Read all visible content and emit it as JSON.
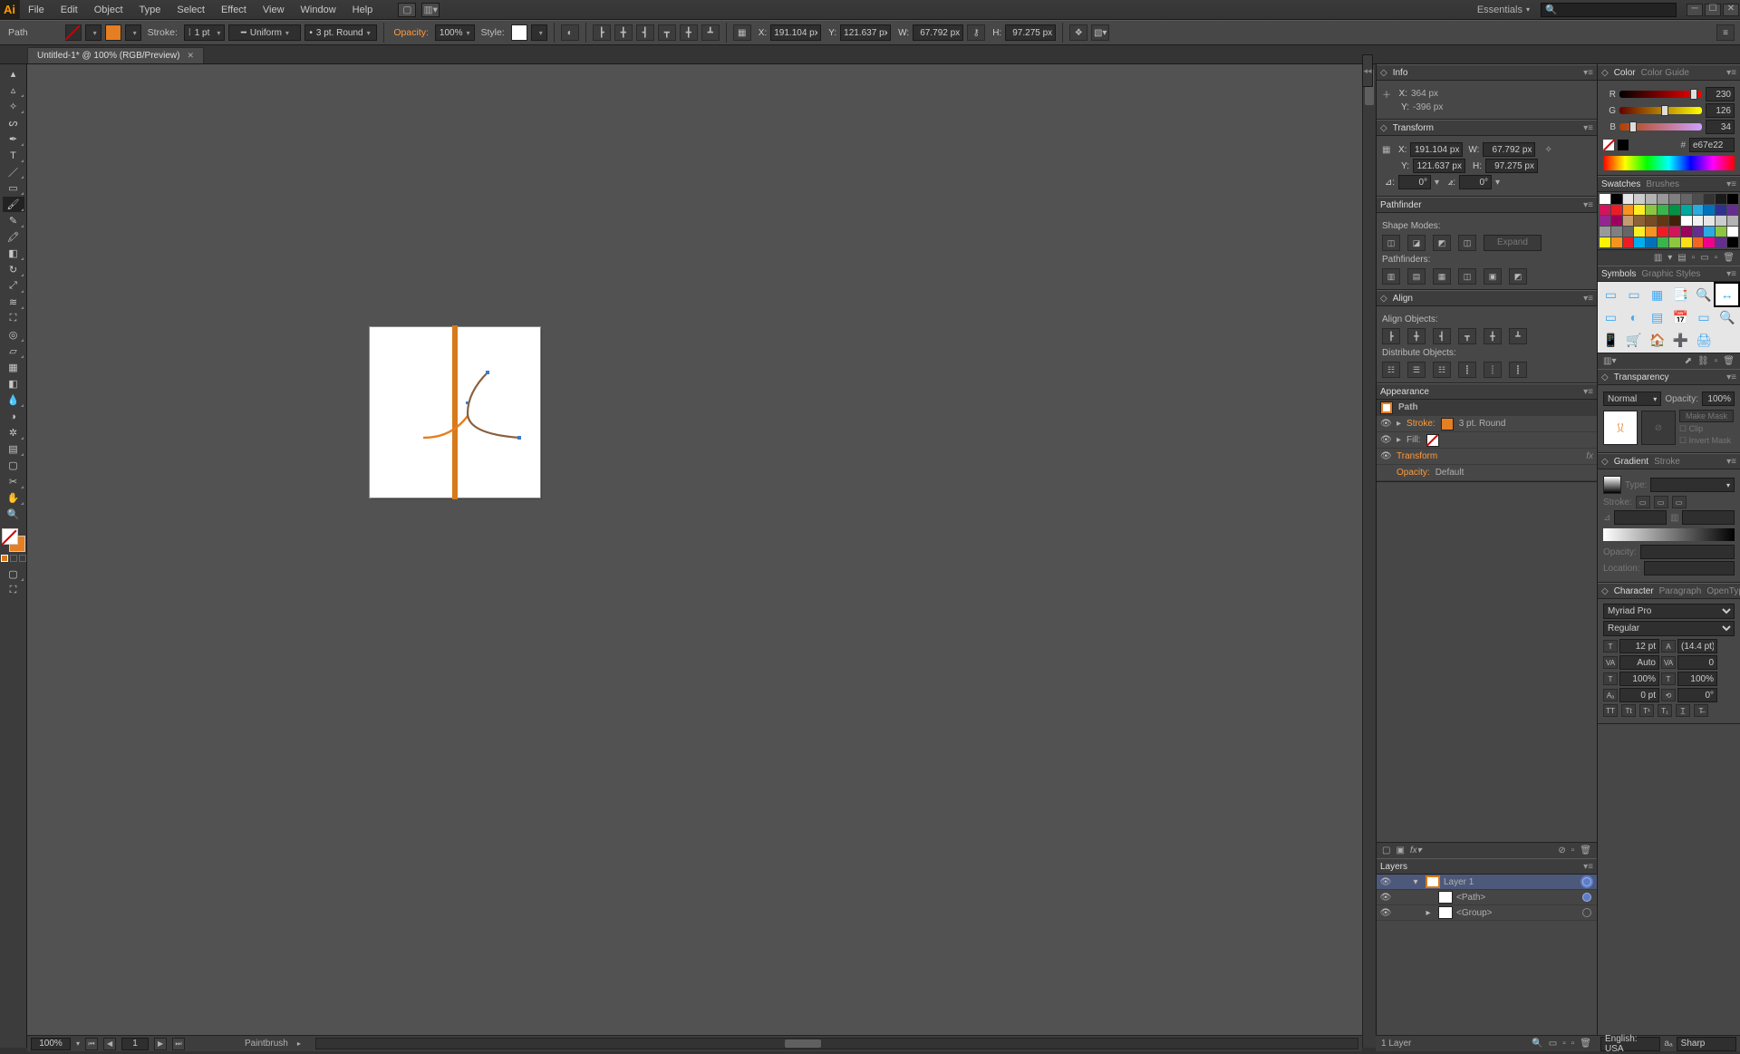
{
  "menu": {
    "items": [
      "File",
      "Edit",
      "Object",
      "Type",
      "Select",
      "Effect",
      "View",
      "Window",
      "Help"
    ],
    "workspace": "Essentials"
  },
  "options": {
    "sel_type": "Path",
    "stroke_label": "Stroke:",
    "stroke_val": "1 pt",
    "brush_profile": "Uniform",
    "brush_def": "3 pt. Round",
    "opacity_label": "Opacity:",
    "opacity_val": "100%",
    "style_label": "Style:",
    "x": "191.104 px",
    "y": "121.637 px",
    "w": "67.792 px",
    "h": "97.275 px",
    "xl": "X:",
    "yl": "Y:",
    "wl": "W:",
    "hl": "H:"
  },
  "tab": {
    "title": "Untitled-1* @ 100% (RGB/Preview)"
  },
  "info": {
    "title": "Info",
    "x": "364 px",
    "y": "-396 px",
    "xl": "X:",
    "yl": "Y:"
  },
  "transform": {
    "title": "Transform",
    "x": "191.104 px",
    "y": "121.637 px",
    "w": "67.792 px",
    "h": "97.275 px",
    "angle": "0°",
    "shear": "0°",
    "xl": "X:",
    "yl": "Y:",
    "wl": "W:",
    "hl": "H:"
  },
  "pathfinder": {
    "title": "Pathfinder",
    "shape_modes": "Shape Modes:",
    "expand": "Expand",
    "pathfinders": "Pathfinders:"
  },
  "align": {
    "title": "Align",
    "align_objects": "Align Objects:",
    "distribute": "Distribute Objects:"
  },
  "appearance": {
    "title": "Appearance",
    "obj": "Path",
    "stroke": "Stroke:",
    "stroke_val": "3 pt. Round",
    "fill": "Fill:",
    "transform": "Transform",
    "opacity": "Opacity:",
    "opacity_val": "Default"
  },
  "layers": {
    "title": "Layers",
    "items": [
      "Layer 1",
      "<Path>",
      "<Group>"
    ],
    "count": "1 Layer"
  },
  "color": {
    "title": "Color",
    "guide": "Color Guide",
    "r": "230",
    "g": "126",
    "b": "34",
    "hex": "e67e22",
    "rl": "R",
    "gl": "G",
    "bl": "B"
  },
  "swatches": {
    "title": "Swatches",
    "brushes": "Brushes",
    "colors": [
      "#fff",
      "#000",
      "#e6e6e6",
      "#ccc",
      "#b3b3b3",
      "#999",
      "#808080",
      "#666",
      "#4d4d4d",
      "#333",
      "#1a1a1a",
      "#000",
      "#d4145a",
      "#ed1c24",
      "#f7931e",
      "#fcee21",
      "#8cc63f",
      "#39b54a",
      "#009245",
      "#00a99d",
      "#29abe2",
      "#0071bc",
      "#2e3192",
      "#662d91",
      "#93278f",
      "#9e005d",
      "#c69c6d",
      "#8c6239",
      "#754c24",
      "#603813",
      "#42210b",
      "#ffffff",
      "#f2f2f2",
      "#e6e6e6",
      "#ccc",
      "#b3b3b3",
      "#999",
      "#808080",
      "#666",
      "#fcee21",
      "#f7931e",
      "#ed1c24",
      "#d4145a",
      "#9e005d",
      "#662d91",
      "#29abe2",
      "#8cc63f",
      "#ffffff",
      "#fff200",
      "#f7941d",
      "#ed1c24",
      "#00aeef",
      "#0072bc",
      "#39b54a",
      "#8dc63f",
      "#ffde17",
      "#f26522",
      "#ec008c",
      "#662d91",
      "#000"
    ]
  },
  "symbols": {
    "title": "Symbols",
    "styles": "Graphic Styles",
    "glyphs": [
      "▭",
      "▭",
      "▦",
      "📑",
      "🔍",
      "↔",
      "▭",
      "◐",
      "▤",
      "📅",
      "▭",
      "🔍",
      "📱",
      "🛒",
      "🏠",
      "➕",
      "🖨"
    ]
  },
  "transparency": {
    "title": "Transparency",
    "mode": "Normal",
    "opacity_label": "Opacity:",
    "opacity": "100%",
    "make_mask": "Make Mask",
    "clip": "Clip",
    "invert": "Invert Mask"
  },
  "gradient": {
    "title": "Gradient",
    "stroke": "Stroke",
    "type": "Type:",
    "stroke_lbl": "Stroke:",
    "opacity": "Opacity:",
    "location": "Location:"
  },
  "character": {
    "title": "Character",
    "para": "Paragraph",
    "ot": "OpenType",
    "font": "Myriad Pro",
    "style": "Regular",
    "size": "12 pt",
    "leading": "(14.4 pt)",
    "kerning": "Auto",
    "tracking": "0",
    "vscale": "100%",
    "hscale": "100%",
    "baseline": "0 pt",
    "rotation": "0°",
    "lang": "English: USA",
    "aa": "Sharp"
  },
  "status": {
    "zoom": "100%",
    "page": "1",
    "tool": "Paintbrush"
  }
}
